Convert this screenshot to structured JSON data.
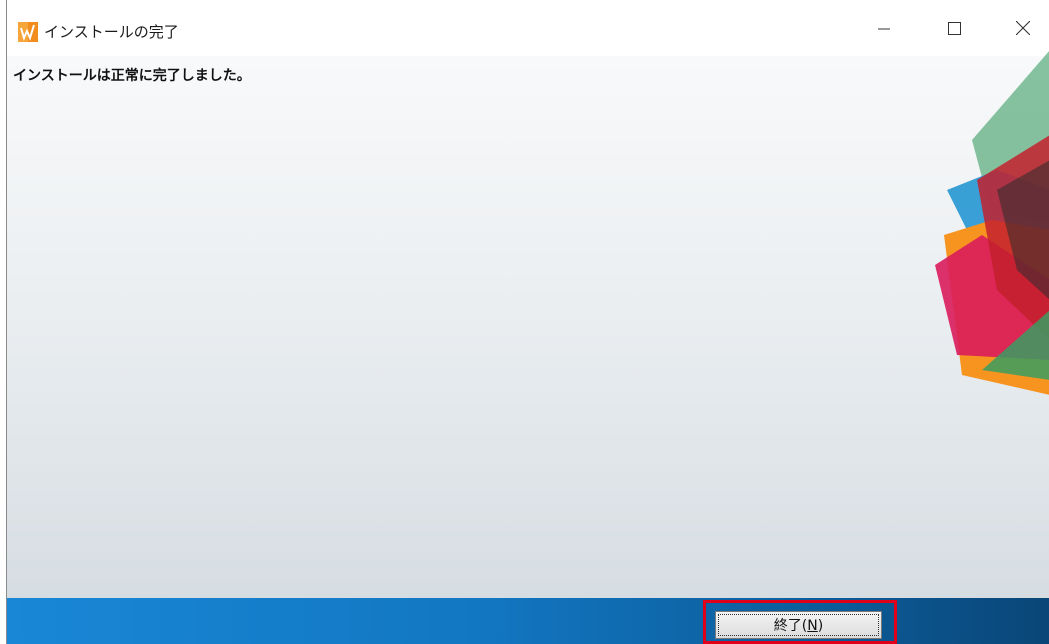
{
  "window": {
    "title": "インストールの完了",
    "controls": {
      "minimize": "minimize-icon",
      "maximize": "maximize-icon",
      "close": "close-icon"
    }
  },
  "message": "インストールは正常に完了しました。",
  "footer": {
    "finish_button": {
      "label": "終了(",
      "mnemonic": "N",
      "suffix": ")"
    }
  },
  "colors": {
    "footer_blue": "#1277c2",
    "highlight_red": "#e0001a",
    "art": [
      "#3a9d62",
      "#1990d0",
      "#f79420",
      "#d91b5b",
      "#c4202e",
      "#2b2b2b"
    ]
  }
}
